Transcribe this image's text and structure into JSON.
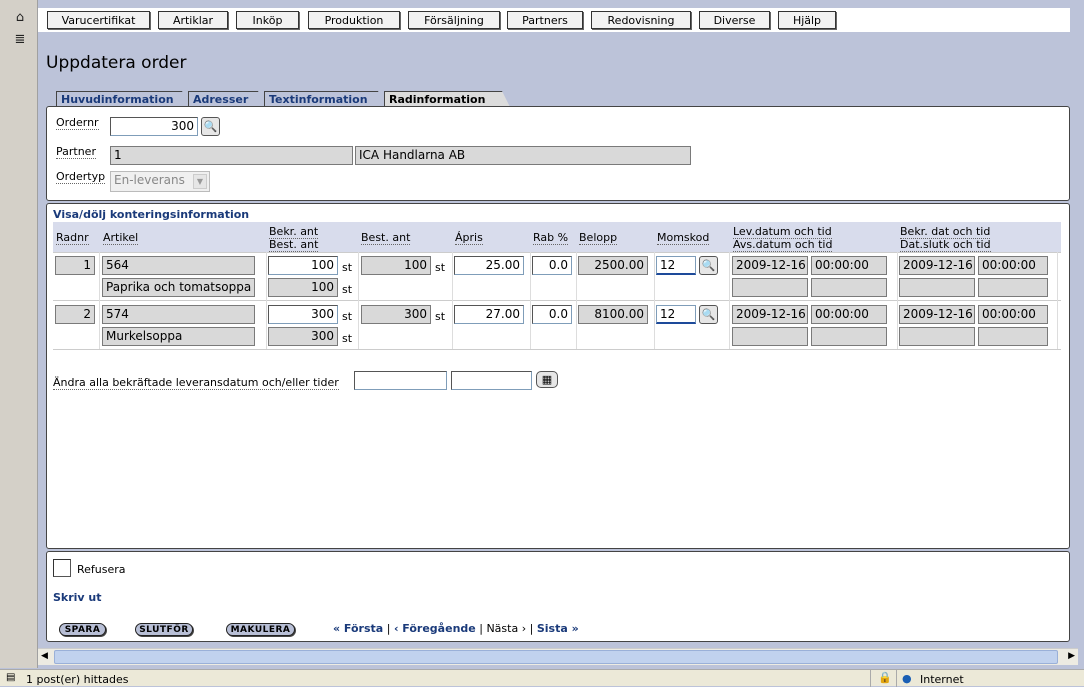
{
  "left_icons": [
    "home-icon",
    "list-icon"
  ],
  "menu": [
    "Varucertifikat",
    "Artiklar",
    "Inköp",
    "Produktion",
    "Försäljning",
    "Partners",
    "Redovisning",
    "Diverse",
    "Hjälp"
  ],
  "page_title": "Uppdatera order",
  "tabs": [
    "Huvudinformation",
    "Adresser",
    "Textinformation",
    "Radinformation"
  ],
  "active_tab": "Radinformation",
  "header": {
    "ordernr_label": "Ordernr",
    "ordernr_value": "300",
    "partner_label": "Partner",
    "partner_id": "1",
    "partner_name": "ICA Handlarna AB",
    "ordertyp_label": "Ordertyp",
    "ordertyp_value": "En-leverans"
  },
  "section_title": "Visa/dölj konteringsinformation",
  "columns": {
    "radnr": "Radnr",
    "artikel": "Artikel",
    "bekr_ant": "Bekr. ant",
    "best_ant_sub": "Best. ant",
    "best_ant": "Best. ant",
    "apris": "Ápris",
    "rab": "Rab %",
    "belopp": "Belopp",
    "momskod": "Momskod",
    "levdatum": "Lev.datum och tid",
    "avsdatum": "Avs.datum och tid",
    "bekrdat": "Bekr. dat och tid",
    "datslut": "Dat.slutk och tid"
  },
  "rows": [
    {
      "radnr": "1",
      "artikel": "564",
      "artikel_name": "Paprika och tomatsoppa",
      "bekr_ant": "100",
      "best_ant_sub": "100",
      "best_ant": "100",
      "unit": "st",
      "apris": "25.00",
      "rab": "0.0",
      "belopp": "2500.00",
      "momskod": "12",
      "lev_date": "2009-12-16",
      "lev_time": "00:00:00",
      "bekr_date": "2009-12-16",
      "bekr_time": "00:00:00"
    },
    {
      "radnr": "2",
      "artikel": "574",
      "artikel_name": "Murkelsoppa",
      "bekr_ant": "300",
      "best_ant_sub": "300",
      "best_ant": "300",
      "unit": "st",
      "apris": "27.00",
      "rab": "0.0",
      "belopp": "8100.00",
      "momskod": "12",
      "lev_date": "2009-12-16",
      "lev_time": "00:00:00",
      "bekr_date": "2009-12-16",
      "bekr_time": "00:00:00"
    }
  ],
  "change_all_label": "Ändra alla bekräftade leveransdatum och/eller tider",
  "refusera_label": "Refusera",
  "print_link": "Skriv ut",
  "buttons": {
    "save": "SPARA",
    "finish": "SLUTFÖR",
    "cancel": "MAKULERA"
  },
  "pager": {
    "first": "« Första",
    "sep1": "|",
    "prev": "‹ Föregående",
    "sep2": "|",
    "next": "Nästa ›",
    "sep3": "|",
    "last": "Sista »"
  },
  "status": {
    "text": "1 post(er) hittades",
    "zone": "Internet"
  },
  "colors": {
    "link": "#1a3a7a",
    "background": "#bcc3d9",
    "panel": "#ffffff"
  }
}
